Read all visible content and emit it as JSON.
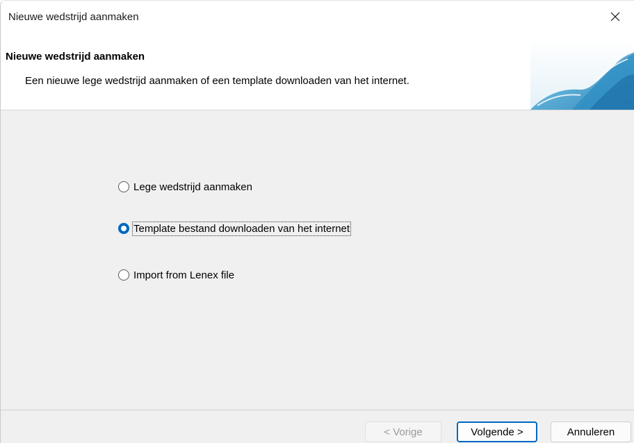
{
  "window": {
    "title": "Nieuwe wedstrijd aanmaken"
  },
  "header": {
    "title": "Nieuwe wedstrijd aanmaken",
    "description": "Een nieuwe lege wedstrijd aanmaken of een template downloaden van het internet.",
    "image_icon": "wave-icon"
  },
  "options": [
    {
      "label": "Lege wedstrijd aanmaken",
      "checked": false
    },
    {
      "label": "Template bestand downloaden van het internet",
      "checked": true
    },
    {
      "label": "Import from Lenex file",
      "checked": false
    }
  ],
  "footer": {
    "back_label": "< Vorige",
    "next_label": "Volgende >",
    "cancel_label": "Annuleren"
  },
  "colors": {
    "accent": "#0067c0",
    "body_background": "#f0f0f0",
    "header_background": "#ffffff"
  }
}
